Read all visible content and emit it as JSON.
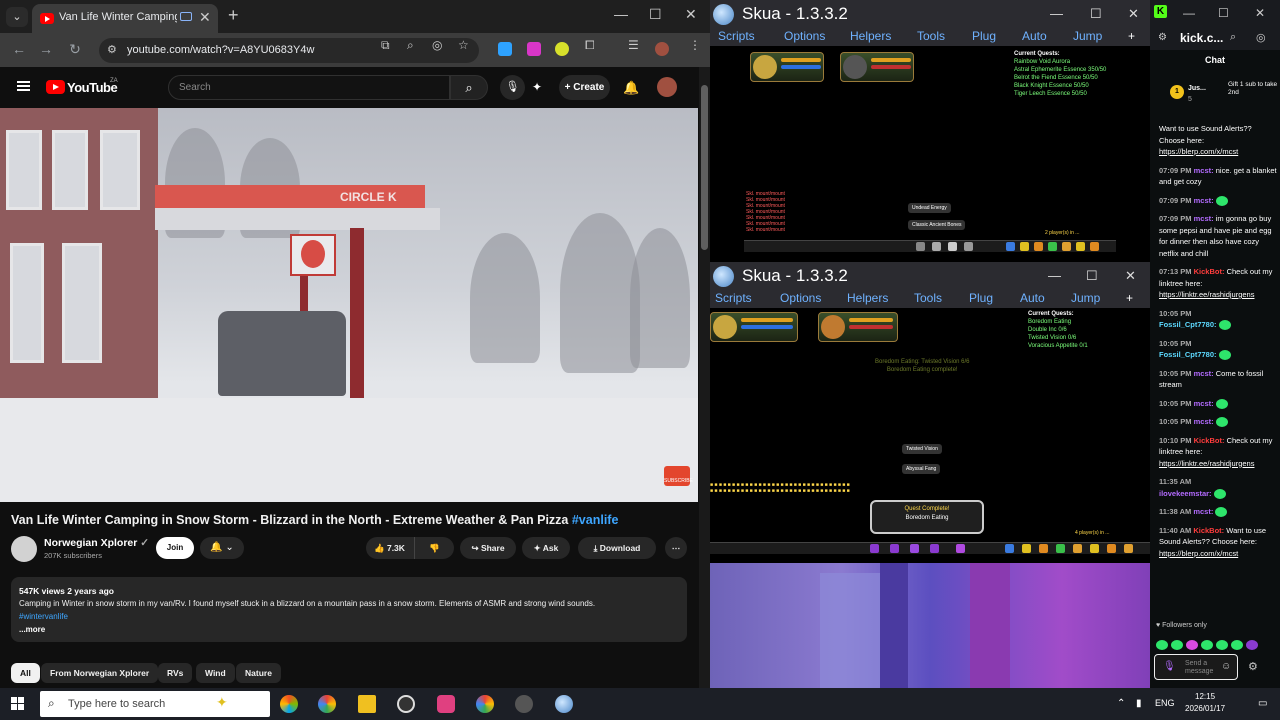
{
  "browser": {
    "tab_title": "Van Life Winter Camping in",
    "url": "youtube.com/watch?v=A8YU0683Y4w"
  },
  "youtube": {
    "logo": "YouTube",
    "country": "ZA",
    "search_placeholder": "Search",
    "create_label": "Create",
    "video": {
      "sign_text": "CIRCLE K",
      "subscribe_badge": "SUBSCRIBE",
      "title": "Van Life Winter Camping in Snow Storm - Blizzard in the North - Extreme Weather & Pan Pizza",
      "title_tag": "#vanlife",
      "channel": "Norwegian Xplorer",
      "subscribers": "207K subscribers",
      "join_label": "Join",
      "likes": "7.3K",
      "share_label": "Share",
      "ask_label": "Ask",
      "download_label": "Download",
      "views_age": "547K views  2 years ago",
      "description": "Camping in Winter in snow storm in my van/Rv. I found myself stuck in a blizzard on a mountain pass in a snow storm. Elements of ASMR and strong wind sounds.",
      "description_tag": "#wintervanlife",
      "more_label": "...more"
    },
    "chips": [
      "All",
      "From Norwegian Xplorer",
      "RVs",
      "Wind",
      "Nature"
    ]
  },
  "skua_top": {
    "title": "Skua - 1.3.3.2",
    "menu": [
      "Scripts",
      "Options",
      "Helpers",
      "Tools",
      "Plug",
      "Auto",
      "Jump"
    ],
    "quest_header": "Current Quests:",
    "quest_lines": [
      "Rainbow Void Aurora",
      "Astral Ephemerite Essence 350/50",
      "Belrot the Fiend Essence 50/50",
      "Black Knight Essence 50/50",
      "Tiger Leech Essence 50/50"
    ],
    "log": [
      "Skl. mount/mount",
      "Skl. mount/mount",
      "Skl. mount/mount",
      "Skl. mount/mount",
      "Skl. mount/mount",
      "Skl. mount/mount",
      "Skl. mount/mount"
    ],
    "popup1": "Undead Energy",
    "popup2": "Classic Ancient Bones",
    "players": "2 player(s) in ..."
  },
  "skua_bottom": {
    "title": "Skua - 1.3.3.2",
    "menu": [
      "Scripts",
      "Options",
      "Helpers",
      "Tools",
      "Plug",
      "Auto",
      "Jump"
    ],
    "quest_header": "Current Quests:",
    "quest_lines": [
      "Boredom Eating",
      "Double Inc 0/6",
      "Twisted Vision 0/6",
      "Voracious Appetite 0/1"
    ],
    "center_msg1": "Boredom Eating: Twisted Vision 6/6",
    "center_msg2": "Boredom Eating complete!",
    "popup1": "Twisted Vision",
    "popup2": "Abyssal Fang",
    "quest_complete": "Quest Complete!",
    "quest_complete_name": "Boredom Eating",
    "players": "4 player(s) in ..."
  },
  "kick": {
    "url": "kick.c...",
    "chat_title": "Chat",
    "pinned_user": "Jus...",
    "pinned_count": "5",
    "pinned_text": "Gift 1 sub to take 2nd",
    "messages": [
      {
        "time": "",
        "user": "",
        "text": "Want to use Sound Alerts?? Choose here:",
        "link": "https://blerp.com/x/mcst"
      },
      {
        "time": "07:09 PM",
        "user": "mcst:",
        "text": "nice. get a blanket and get cozy",
        "link": ""
      },
      {
        "time": "07:09 PM",
        "user": "mcst:",
        "text": "",
        "link": ""
      },
      {
        "time": "07:09 PM",
        "user": "mcst:",
        "text": "im gonna go buy some pepsi and have pie and egg for dinner then also have cozy netflix and chill",
        "link": ""
      },
      {
        "time": "07:13 PM",
        "user": "KickBot:",
        "text": "Check out my linktree here:",
        "link": "https://linktr.ee/rashidjurgens"
      },
      {
        "time": "10:05 PM",
        "user": "Fossil_Cpt7780:",
        "text": "",
        "link": ""
      },
      {
        "time": "10:05 PM",
        "user": "Fossil_Cpt7780:",
        "text": "",
        "link": ""
      },
      {
        "time": "10:05 PM",
        "user": "mcst:",
        "text": "Come to fossil stream",
        "link": ""
      },
      {
        "time": "10:05 PM",
        "user": "mcst:",
        "text": "",
        "link": ""
      },
      {
        "time": "10:05 PM",
        "user": "mcst:",
        "text": "",
        "link": ""
      },
      {
        "time": "10:10 PM",
        "user": "KickBot:",
        "text": "Check out my linktree here:",
        "link": "https://linktr.ee/rashidjurgens"
      },
      {
        "time": "11:35 AM",
        "user": "ilovekeemstar:",
        "text": "",
        "link": ""
      },
      {
        "time": "11:38 AM",
        "user": "mcst:",
        "text": "",
        "link": ""
      },
      {
        "time": "11:40 AM",
        "user": "KickBot:",
        "text": "Want to use Sound Alerts?? Choose here:",
        "link": "https://blerp.com/x/mcst"
      }
    ],
    "followers_only": "Followers only",
    "send_placeholder": "Send a message"
  },
  "taskbar": {
    "search_placeholder": "Type here to search",
    "lang": "ENG",
    "time": "12:15",
    "date": "2026/01/17"
  }
}
